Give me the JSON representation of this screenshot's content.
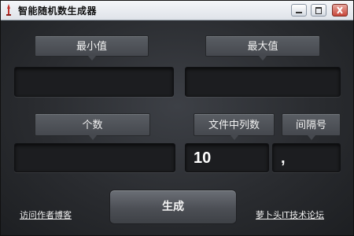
{
  "window": {
    "title": "智能随机数生成器",
    "controls": {
      "minimize_icon": "minimize-icon",
      "maximize_icon": "maximize-icon",
      "close_icon": "close-icon"
    }
  },
  "labels": {
    "min": "最小值",
    "max": "最大值",
    "count": "个数",
    "columns": "文件中列数",
    "separator": "间隔号"
  },
  "fields": {
    "min_value": "",
    "max_value": "",
    "count_value": "",
    "columns_value": "10",
    "separator_value": ","
  },
  "generate_label": "生成",
  "links": {
    "visit_blog": "访问作者博客",
    "forum": "萝卜头IT技术论坛"
  },
  "colors": {
    "background": "#2b2d31",
    "label_button": "#4f5258",
    "field": "#1c1d20",
    "text": "#ffffff",
    "close_button": "#c8463a"
  }
}
